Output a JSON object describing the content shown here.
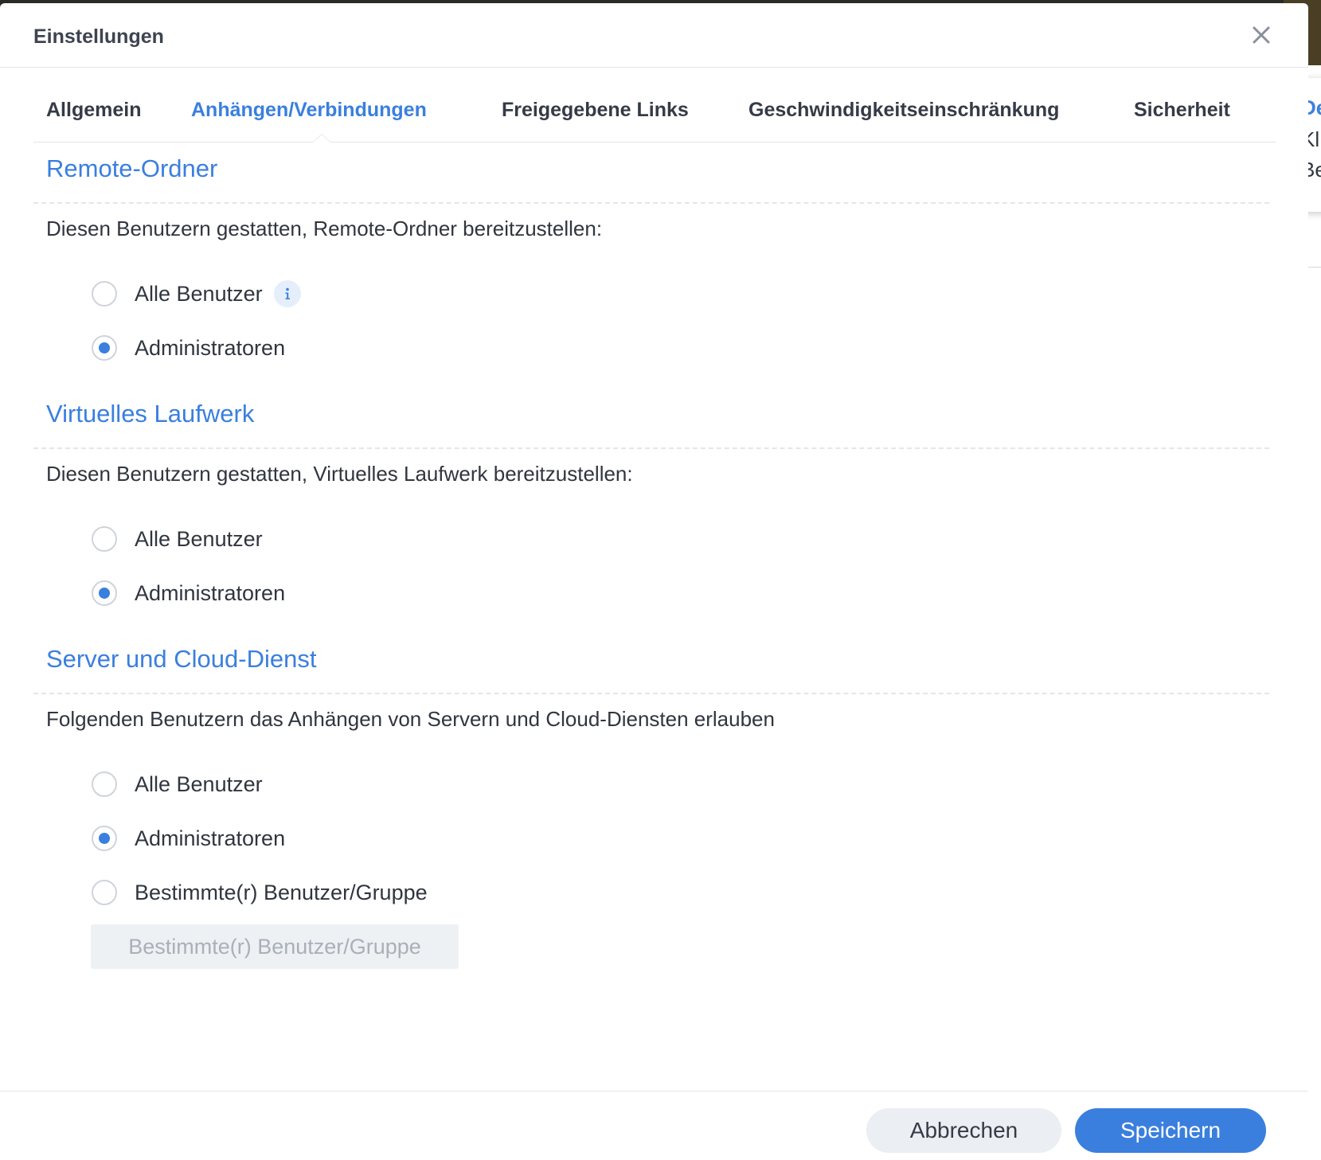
{
  "dialog": {
    "title": "Einstellungen"
  },
  "tabs": [
    {
      "label": "Allgemein"
    },
    {
      "label": "Anhängen/Verbindungen",
      "active": true
    },
    {
      "label": "Freigegebene Links"
    },
    {
      "label": "Geschwindigkeitseinschränkung"
    },
    {
      "label": "Sicherheit"
    }
  ],
  "popover": {
    "title": "De",
    "line1": "Kl",
    "line2": "Be"
  },
  "sections": [
    {
      "title": "Remote-Ordner",
      "description": "Diesen Benutzern gestatten, Remote-Ordner bereitzustellen:",
      "options": [
        {
          "label": "Alle Benutzer",
          "checked": false,
          "info": true
        },
        {
          "label": "Administratoren",
          "checked": true
        }
      ]
    },
    {
      "title": "Virtuelles Laufwerk",
      "description": "Diesen Benutzern gestatten, Virtuelles Laufwerk bereitzustellen:",
      "options": [
        {
          "label": "Alle Benutzer",
          "checked": false
        },
        {
          "label": "Administratoren",
          "checked": true
        }
      ]
    },
    {
      "title": "Server und Cloud-Dienst",
      "description": "Folgenden Benutzern das Anhängen von Servern und Cloud-Diensten erlauben",
      "options": [
        {
          "label": "Alle Benutzer",
          "checked": false
        },
        {
          "label": "Administratoren",
          "checked": true
        },
        {
          "label": "Bestimmte(r) Benutzer/Gruppe",
          "checked": false
        }
      ],
      "picker_button": "Bestimmte(r) Benutzer/Gruppe"
    }
  ],
  "footer": {
    "cancel": "Abbrechen",
    "save": "Speichern"
  },
  "colors": {
    "accent": "#3a7fde",
    "text": "#30353f",
    "muted": "#a9b0b8"
  },
  "icons": {
    "close": "close-icon",
    "info": "info-icon"
  }
}
